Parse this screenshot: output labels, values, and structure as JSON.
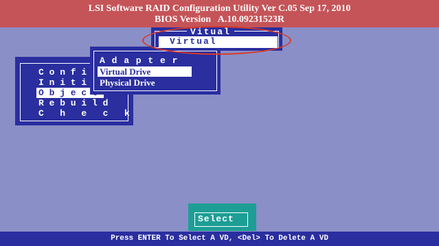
{
  "header": {
    "title": "LSI Software RAID Configuration Utility Ver C.05 Sep 17, 2010",
    "bios": "BIOS Version   A.10.09231523R"
  },
  "main_menu": {
    "items": [
      {
        "label": "C o n f i g"
      },
      {
        "label": "I n i t i a l"
      },
      {
        "label": "O b j e c t s"
      },
      {
        "label": "R e b u i l d"
      },
      {
        "label": "C   h   e   c   k"
      }
    ],
    "selected_index": 2
  },
  "objects_menu": {
    "items": [
      {
        "label": "A d a p t e r"
      },
      {
        "label": "Virtual Drive"
      },
      {
        "label": "Physical Drive"
      }
    ],
    "selected_index": 1
  },
  "virtual_window": {
    "title": "Vitual",
    "item": "Virtual"
  },
  "select_button": {
    "label": "Select"
  },
  "footer": {
    "hint": "Press ENTER To Select A VD, <Del> To Delete A VD"
  },
  "colors": {
    "background": "#8a8fc7",
    "title_bar": "#c55458",
    "window": "#2a2e9f",
    "select_panel": "#1d9e95",
    "highlight": "#d83a2a"
  }
}
